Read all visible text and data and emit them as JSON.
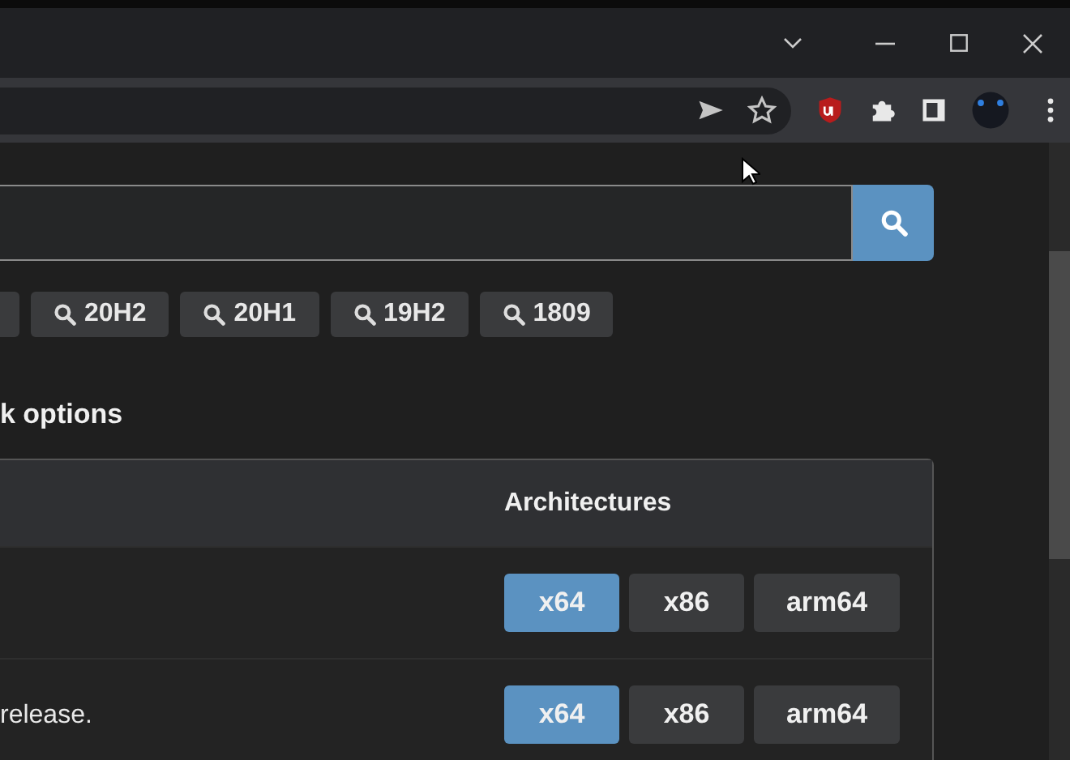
{
  "version_tags": [
    {
      "kind": "partial"
    },
    {
      "kind": "tag",
      "label": "20H2"
    },
    {
      "kind": "tag",
      "label": "20H1"
    },
    {
      "kind": "tag",
      "label": "19H2"
    },
    {
      "kind": "tag",
      "label": "1809"
    }
  ],
  "section_heading": "k options",
  "table": {
    "architectures_header": "Architectures",
    "rows": [
      {
        "architectures": [
          {
            "label": "x64",
            "selected": true
          },
          {
            "label": "x86",
            "selected": false
          },
          {
            "label": "arm64",
            "selected": false
          }
        ]
      },
      {
        "text": "release.",
        "architectures": [
          {
            "label": "x64",
            "selected": true
          },
          {
            "label": "x86",
            "selected": false
          },
          {
            "label": "arm64",
            "selected": false
          }
        ]
      }
    ]
  }
}
